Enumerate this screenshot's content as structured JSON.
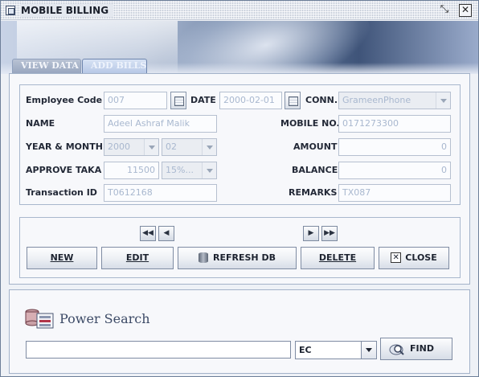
{
  "window": {
    "title": "MOBILE BILLING",
    "maximize_glyph": "⤡",
    "close_glyph": "✕"
  },
  "tabs": [
    {
      "label": "VIEW DATA",
      "selected": false
    },
    {
      "label": "ADD BILLS",
      "selected": true
    }
  ],
  "form": {
    "employee_code": {
      "label": "Employee Code",
      "value": "007"
    },
    "date": {
      "label": "DATE",
      "value": "2000-02-01"
    },
    "conn": {
      "label": "CONN.",
      "value": "GrameenPhone"
    },
    "name": {
      "label": "NAME",
      "value": "Adeel Ashraf Malik"
    },
    "mobile_no": {
      "label": "MOBILE NO.",
      "value": "0171273300"
    },
    "year_month": {
      "label": "YEAR & MONTH",
      "year": "2000",
      "month": "02"
    },
    "amount": {
      "label": "AMOUNT",
      "value": "0"
    },
    "approve_taka": {
      "label": "APPROVE TAKA",
      "value": "11500",
      "percent": "15%..."
    },
    "balance": {
      "label": "BALANCE",
      "value": "0"
    },
    "transaction_id": {
      "label": "Transaction ID",
      "value": "T0612168"
    },
    "remarks": {
      "label": "REMARKS",
      "value": "TX087"
    }
  },
  "nav": {
    "first": "◀◀",
    "prev": "◀",
    "next": "▶",
    "last": "▶▶"
  },
  "actions": {
    "new_label": "NEW",
    "edit_label": "EDIT",
    "refresh_label": "REFRESH DB",
    "delete_label": "DELETE",
    "close_label": "CLOSE",
    "close_icon_glyph": "✕"
  },
  "search": {
    "title": "Power Search",
    "query": "",
    "field": "EC",
    "find_label": "FIND"
  },
  "colors": {
    "accent": "#7f8ca3",
    "disabled_text": "#a9b8cf"
  }
}
